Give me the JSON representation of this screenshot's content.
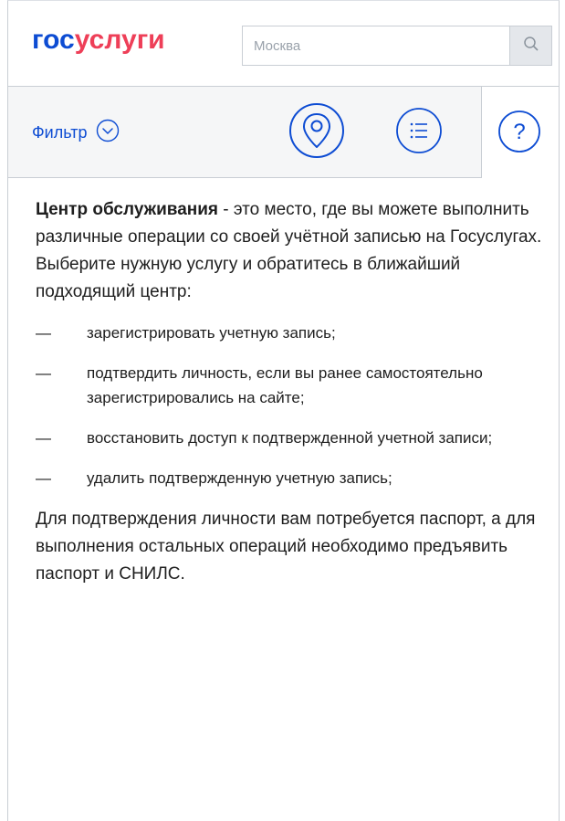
{
  "header": {
    "logo_part1": "гос",
    "logo_part2": "услуги",
    "search_placeholder": "Москва",
    "search_icon": "magnifier-icon"
  },
  "toolbar": {
    "filter_label": "Фильтр",
    "filter_icon": "chevron-down-circle-icon",
    "map_icon": "map-pin-icon",
    "list_icon": "list-icon",
    "help_icon": "question-mark-icon",
    "help_glyph": "?"
  },
  "content": {
    "intro_bold": "Центр обслуживания",
    "intro_rest": " - это место, где вы можете выполнить различные операции со своей учётной записью на Госуслугах. Выберите нужную услугу и обратитесь в ближайший подходящий центр:",
    "dash": "—",
    "operations": [
      "зарегистрировать учетную запись;",
      "подтвердить личность, если вы ранее самостоятельно зарегистрировались на сайте;",
      "восстановить доступ к подтвержденной учетной записи;",
      "удалить подтвержденную учетную запись;"
    ],
    "outro": "Для подтверждения личности вам потребуется паспорт, а для выполнения остальных операций необходимо предъявить паспорт и СНИЛС."
  },
  "colors": {
    "brand_blue": "#0d4cd3",
    "brand_red": "#ee3f58",
    "toolbar_bg": "#f5f6f7",
    "border": "#c9ced4"
  }
}
